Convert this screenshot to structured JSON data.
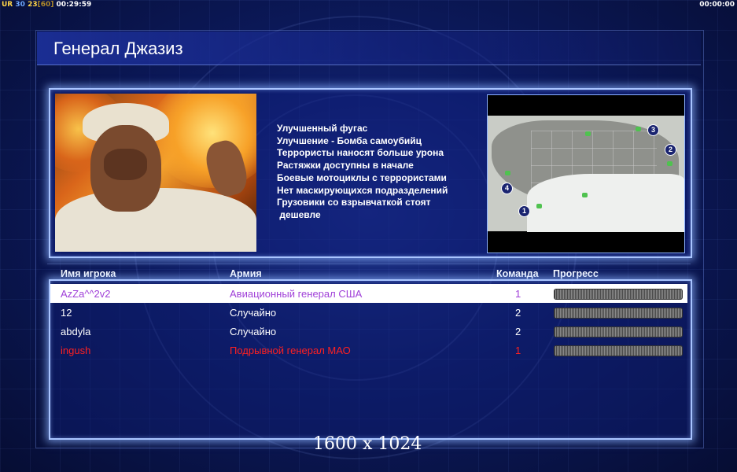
{
  "status_bar": {
    "ur_label": "UR",
    "value1": "30",
    "value2": "23",
    "value3": "[60]",
    "elapsed": "00:29:59",
    "timer": "00:00:00"
  },
  "general": {
    "title": "Генерал Джазиз",
    "perks": [
      "Улучшенный фугас",
      "Улучшение - Бомба самоубийц",
      "Террористы наносят больше урона",
      "Растяжки доступны в начале",
      "Боевые мотоциклы с террористами",
      "Нет маскирующихся подразделений",
      "Грузовики со взрывчаткой стоят",
      " дешевле"
    ]
  },
  "map": {
    "spawns": [
      "1",
      "2",
      "3",
      "4"
    ]
  },
  "table": {
    "headers": {
      "player": "Имя игрока",
      "army": "Армия",
      "team": "Команда",
      "progress": "Прогресс"
    },
    "rows": [
      {
        "name": "AzZa^^2v2",
        "army": "Авиационный генерал США",
        "team": "1",
        "color": "#a040d8",
        "selected": true
      },
      {
        "name": "12",
        "army": "Случайно",
        "team": "2",
        "color": "#ffffff",
        "selected": false
      },
      {
        "name": "abdyla",
        "army": "Случайно",
        "team": "2",
        "color": "#ffffff",
        "selected": false
      },
      {
        "name": "ingush",
        "army": "Подрывной генерал МАО",
        "team": "1",
        "color": "#ff2020",
        "selected": false
      }
    ]
  },
  "resolution_label": "1600 x 1024",
  "colors": {
    "background": "#0c1a5e",
    "panel_border": "#a9c4ff",
    "status_yellow": "#ffd54a"
  }
}
